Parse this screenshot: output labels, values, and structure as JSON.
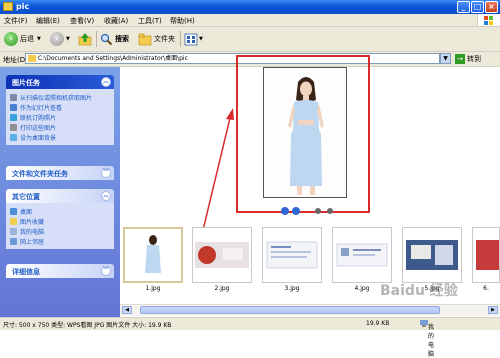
{
  "window": {
    "title": "pic"
  },
  "menu": [
    "文件(F)",
    "编辑(E)",
    "查看(V)",
    "收藏(A)",
    "工具(T)",
    "帮助(H)"
  ],
  "toolbar": {
    "back": "后退",
    "search": "搜索",
    "folders": "文件夹"
  },
  "address": {
    "label": "地址(D)",
    "path": "C:\\Documents and Settings\\Administrator\\桌面\\pic",
    "go": "转到"
  },
  "sidebar": {
    "picture_tasks": {
      "title": "图片任务",
      "items": [
        "从扫描仪或照相机获取图片",
        "作为幻灯片查看",
        "联机订购照片",
        "打印这些图片",
        "设为桌面背景"
      ]
    },
    "file_tasks": {
      "title": "文件和文件夹任务"
    },
    "other_places": {
      "title": "其它位置",
      "items": [
        "桌面",
        "图片收藏",
        "我的电脑",
        "网上邻居"
      ]
    },
    "details": {
      "title": "详细信息"
    }
  },
  "thumbnails": [
    {
      "label": "1.jpg"
    },
    {
      "label": "2.jpg"
    },
    {
      "label": "3.jpg"
    },
    {
      "label": "4.jpg"
    },
    {
      "label": "5.jpg"
    },
    {
      "label": "6."
    }
  ],
  "status": {
    "info": "尺寸: 500 x 750 类型: WPS看图 JPG 图片文件 大小: 19.9 KB",
    "size": "19.9 KB",
    "location": "我的电脑"
  },
  "watermark": "Baidu 经验",
  "colors": {
    "accent": "#0a55d8",
    "highlight": "#d92b2b"
  }
}
